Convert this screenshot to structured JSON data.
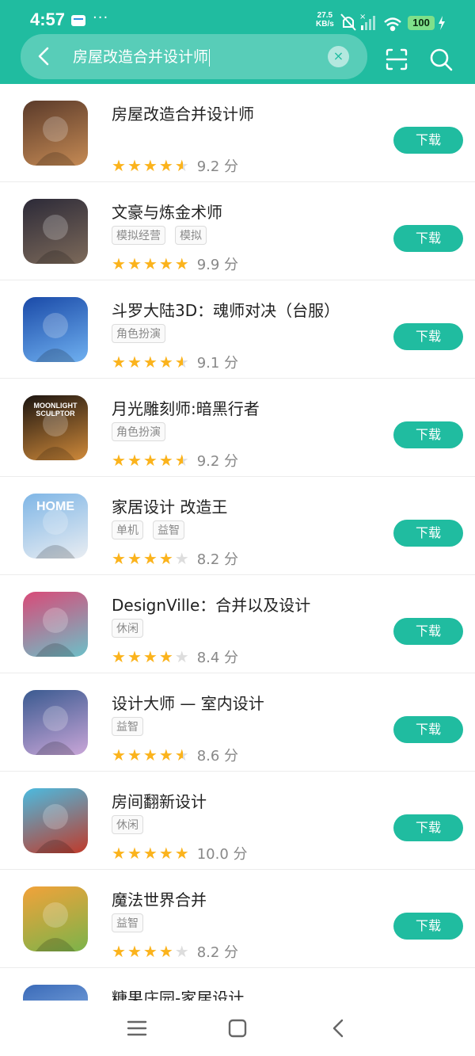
{
  "status": {
    "time": "4:57",
    "dots": "···",
    "speed_value": "27.5",
    "speed_unit": "KB/s",
    "battery": "100"
  },
  "search": {
    "query": "房屋改造合并设计师",
    "clear": "×"
  },
  "apps": [
    {
      "title": "房屋改造合并设计师",
      "tags": [],
      "stars": "4.5",
      "score": "9.2 分",
      "button": "下载",
      "icon": "woman-portrait-icon",
      "icon_colors": [
        "#5a3a2a",
        "#c58a54"
      ]
    },
    {
      "title": "文豪与炼金术师",
      "tags": [
        "模拟经营",
        "模拟"
      ],
      "stars": "5",
      "score": "9.9 分",
      "button": "下载",
      "icon": "anime-man-icon",
      "icon_colors": [
        "#2c2a38",
        "#7d6a5a"
      ]
    },
    {
      "title": "斗罗大陆3D：魂师对决（台服）",
      "tags": [
        "角色扮演"
      ],
      "stars": "4.5",
      "score": "9.1 分",
      "button": "下载",
      "icon": "blue-hero-icon",
      "icon_colors": [
        "#1a4aa8",
        "#6fb0f0"
      ]
    },
    {
      "title": "月光雕刻师:暗黑行者",
      "tags": [
        "角色扮演"
      ],
      "stars": "4.5",
      "score": "9.2 分",
      "button": "下载",
      "icon": "moonlight-sculptor-logo-icon",
      "icon_colors": [
        "#1b1410",
        "#d08a3a"
      ],
      "icon_text": "MOONLIGHT SCULPTOR"
    },
    {
      "title": "家居设计 改造王",
      "tags": [
        "单机",
        "益智"
      ],
      "stars": "4",
      "score": "8.2 分",
      "button": "下载",
      "icon": "home-house-icon",
      "icon_colors": [
        "#7fb6e6",
        "#e9edf2"
      ],
      "icon_text": "HOME"
    },
    {
      "title": "DesignVille：合并以及设计",
      "tags": [
        "休闲"
      ],
      "stars": "4",
      "score": "8.4 分",
      "button": "下载",
      "icon": "couple-umbrella-icon",
      "icon_colors": [
        "#d94a78",
        "#6cc0c8"
      ]
    },
    {
      "title": "设计大师 — 室内设计",
      "tags": [
        "益智"
      ],
      "stars": "4.5",
      "score": "8.6 分",
      "button": "下载",
      "icon": "mother-baby-icon",
      "icon_colors": [
        "#3a5a90",
        "#c9a6d8"
      ]
    },
    {
      "title": "房间翻新设计",
      "tags": [
        "休闲"
      ],
      "stars": "5",
      "score": "10.0 分",
      "button": "下载",
      "icon": "redhead-crystal-icon",
      "icon_colors": [
        "#4bbbe0",
        "#c03a2a"
      ]
    },
    {
      "title": "魔法世界合并",
      "tags": [
        "益智"
      ],
      "stars": "4",
      "score": "8.2 分",
      "button": "下载",
      "icon": "grass-cube-icon",
      "icon_colors": [
        "#f2a23a",
        "#7bb34a"
      ]
    },
    {
      "title": "糖果庄园-家居设计",
      "tags": [],
      "stars": "0",
      "score": "",
      "button": "",
      "icon": "candy-manor-icon",
      "icon_colors": [
        "#3a6ab8",
        "#9ac2f0"
      ]
    }
  ],
  "colors": {
    "accent": "#20bca0",
    "star": "#fbb31c"
  }
}
